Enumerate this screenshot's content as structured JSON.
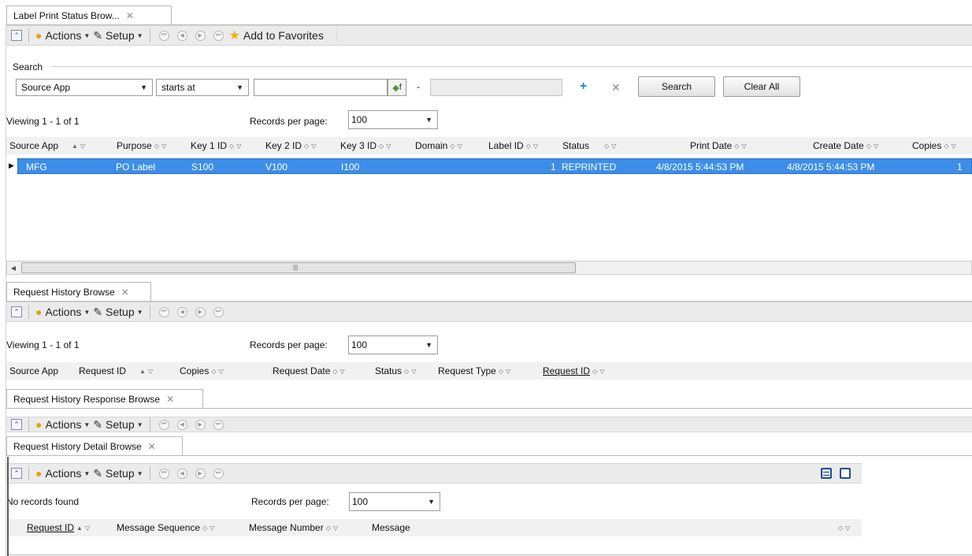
{
  "panel1": {
    "tab": "Label Print Status Brow...",
    "toolbar": {
      "actions": "Actions",
      "setup": "Setup",
      "favorites": "Add to Favorites"
    },
    "search": {
      "group_label": "Search",
      "field": "Source App",
      "operator": "starts at",
      "value": "",
      "range_sep": "-",
      "fx": "f",
      "search_btn": "Search",
      "clear_btn": "Clear All"
    },
    "viewing": "Viewing 1 - 1 of 1",
    "records_label": "Records per page:",
    "records_value": "100",
    "columns": [
      "Source App",
      "Purpose",
      "Key 1 ID",
      "Key 2 ID",
      "Key 3 ID",
      "Domain",
      "Label ID",
      "Status",
      "Print Date",
      "Create Date",
      "Copies"
    ],
    "row": {
      "source_app": "MFG",
      "purpose": "PO Label",
      "key1": "S100",
      "key2": "V100",
      "key3": "I100",
      "label_id": "1",
      "status": "REPRINTED",
      "print_date": "4/8/2015 5:44:53 PM",
      "create_date": "4/8/2015 5:44:53 PM",
      "copies": "1"
    }
  },
  "panel2": {
    "tab": "Request History Browse",
    "toolbar": {
      "actions": "Actions",
      "setup": "Setup"
    },
    "viewing": "Viewing 1 - 1 of 1",
    "records_label": "Records per page:",
    "records_value": "100",
    "columns": [
      "Source App",
      "Request ID",
      "Copies",
      "Request Date",
      "Status",
      "Request Type",
      "Request ID"
    ]
  },
  "panel3": {
    "tab": "Request History Response Browse",
    "toolbar": {
      "actions": "Actions",
      "setup": "Setup"
    }
  },
  "panel4": {
    "tab": "Request History Detail Browse",
    "toolbar": {
      "actions": "Actions",
      "setup": "Setup"
    },
    "viewing": "No records found",
    "records_label": "Records per page:",
    "records_value": "100",
    "columns": [
      "Request ID",
      "Message Sequence",
      "Message Number",
      "Message"
    ]
  }
}
